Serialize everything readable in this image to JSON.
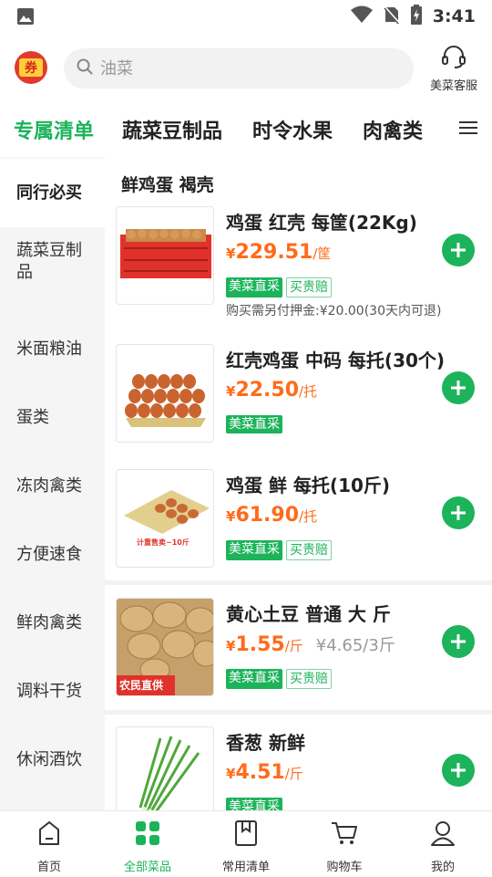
{
  "status_bar": {
    "time": "3:41"
  },
  "header": {
    "coupon_label": "券",
    "search_placeholder": "油菜",
    "service_label": "美菜客服"
  },
  "tabs": [
    {
      "label": "专属清单",
      "active": true
    },
    {
      "label": "蔬菜豆制品",
      "active": false
    },
    {
      "label": "时令水果",
      "active": false
    },
    {
      "label": "肉禽类",
      "active": false
    }
  ],
  "sidebar": [
    {
      "label": "同行必买",
      "active": true
    },
    {
      "label": "蔬菜豆制品",
      "active": false
    },
    {
      "label": "米面粮油",
      "active": false
    },
    {
      "label": "蛋类",
      "active": false
    },
    {
      "label": "冻肉禽类",
      "active": false
    },
    {
      "label": "方便速食",
      "active": false
    },
    {
      "label": "鲜肉禽类",
      "active": false
    },
    {
      "label": "调料干货",
      "active": false
    },
    {
      "label": "休闲酒饮",
      "active": false
    }
  ],
  "section_title": "鲜鸡蛋 褐壳",
  "products": [
    {
      "name": "鸡蛋 红壳 每筐(22Kg)",
      "currency": "¥",
      "price": "229.51",
      "unit": "/筐",
      "orig_price": "",
      "tags": [
        "美菜直采",
        "买贵赔"
      ],
      "deposit": "购买需另付押金:¥20.00(30天内可退)",
      "image": "egg-crate"
    },
    {
      "name": "红壳鸡蛋 中码 每托(30个)",
      "currency": "¥",
      "price": "22.50",
      "unit": "/托",
      "orig_price": "",
      "tags": [
        "美菜直采"
      ],
      "deposit": "",
      "image": "egg-tray"
    },
    {
      "name": "鸡蛋 鲜 每托(10斤)",
      "currency": "¥",
      "price": "61.90",
      "unit": "/托",
      "orig_price": "",
      "tags": [
        "美菜直采",
        "买贵赔"
      ],
      "deposit": "",
      "image": "egg-tray-weighed",
      "image_caption": "计重售卖~10斤"
    },
    {
      "name": "黄心土豆 普通 大 斤",
      "currency": "¥",
      "price": "1.55",
      "unit": "/斤",
      "orig_price": "¥4.65/3斤",
      "tags": [
        "美菜直采",
        "买贵赔"
      ],
      "deposit": "",
      "image": "potatoes",
      "image_caption": "农民直供"
    },
    {
      "name": "香葱  新鲜",
      "currency": "¥",
      "price": "4.51",
      "unit": "/斤",
      "orig_price": "",
      "tags": [
        "美菜直采"
      ],
      "deposit": "",
      "image": "scallions"
    }
  ],
  "bottom_nav": [
    {
      "label": "首页",
      "icon": "home-icon",
      "active": false
    },
    {
      "label": "全部菜品",
      "icon": "grid-icon",
      "active": true
    },
    {
      "label": "常用清单",
      "icon": "bookmark-icon",
      "active": false
    },
    {
      "label": "购物车",
      "icon": "cart-icon",
      "active": false
    },
    {
      "label": "我的",
      "icon": "profile-icon",
      "active": false
    }
  ],
  "colors": {
    "accent": "#1cb35b",
    "price": "#ff6b1a",
    "coupon": "#e23a2e"
  }
}
